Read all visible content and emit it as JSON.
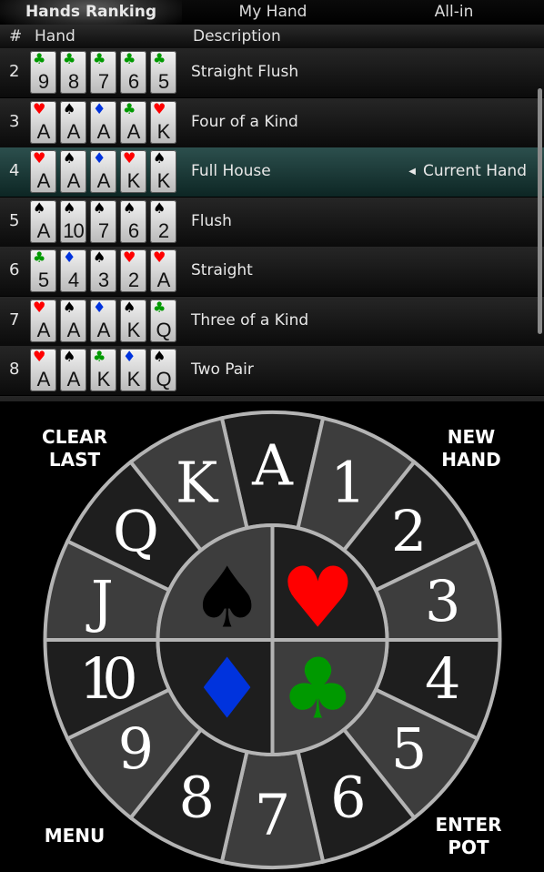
{
  "tabs": [
    {
      "label": "Hands Ranking",
      "active": true
    },
    {
      "label": "My Hand",
      "active": false
    },
    {
      "label": "All-in",
      "active": false
    }
  ],
  "table": {
    "columns": {
      "rank": "#",
      "hand": "Hand",
      "description": "Description"
    },
    "current_marker": "Current Hand",
    "rows": [
      {
        "rank": "2",
        "description": "Straight Flush",
        "current": false,
        "cards": [
          {
            "suit": "clubs",
            "value": "9"
          },
          {
            "suit": "clubs",
            "value": "8"
          },
          {
            "suit": "clubs",
            "value": "7"
          },
          {
            "suit": "clubs",
            "value": "6"
          },
          {
            "suit": "clubs",
            "value": "5"
          }
        ]
      },
      {
        "rank": "3",
        "description": "Four of a Kind",
        "current": false,
        "cards": [
          {
            "suit": "hearts",
            "value": "A"
          },
          {
            "suit": "spades",
            "value": "A"
          },
          {
            "suit": "diamonds",
            "value": "A"
          },
          {
            "suit": "clubs",
            "value": "A"
          },
          {
            "suit": "hearts",
            "value": "K"
          }
        ]
      },
      {
        "rank": "4",
        "description": "Full House",
        "current": true,
        "cards": [
          {
            "suit": "hearts",
            "value": "A"
          },
          {
            "suit": "spades",
            "value": "A"
          },
          {
            "suit": "diamonds",
            "value": "A"
          },
          {
            "suit": "hearts",
            "value": "K"
          },
          {
            "suit": "spades",
            "value": "K"
          }
        ]
      },
      {
        "rank": "5",
        "description": "Flush",
        "current": false,
        "cards": [
          {
            "suit": "spades",
            "value": "A"
          },
          {
            "suit": "spades",
            "value": "10"
          },
          {
            "suit": "spades",
            "value": "7"
          },
          {
            "suit": "spades",
            "value": "6"
          },
          {
            "suit": "spades",
            "value": "2"
          }
        ]
      },
      {
        "rank": "6",
        "description": "Straight",
        "current": false,
        "cards": [
          {
            "suit": "clubs",
            "value": "5"
          },
          {
            "suit": "diamonds",
            "value": "4"
          },
          {
            "suit": "spades",
            "value": "3"
          },
          {
            "suit": "hearts",
            "value": "2"
          },
          {
            "suit": "hearts",
            "value": "A"
          }
        ]
      },
      {
        "rank": "7",
        "description": "Three of a Kind",
        "current": false,
        "cards": [
          {
            "suit": "hearts",
            "value": "A"
          },
          {
            "suit": "spades",
            "value": "A"
          },
          {
            "suit": "diamonds",
            "value": "A"
          },
          {
            "suit": "spades",
            "value": "K"
          },
          {
            "suit": "clubs",
            "value": "Q"
          }
        ]
      },
      {
        "rank": "8",
        "description": "Two Pair",
        "current": false,
        "cards": [
          {
            "suit": "hearts",
            "value": "A"
          },
          {
            "suit": "spades",
            "value": "A"
          },
          {
            "suit": "clubs",
            "value": "K"
          },
          {
            "suit": "diamonds",
            "value": "K"
          },
          {
            "suit": "spades",
            "value": "Q"
          }
        ]
      }
    ]
  },
  "suits": {
    "spades": {
      "glyph": "♠",
      "color": "#000000",
      "icon": "spade-icon"
    },
    "hearts": {
      "glyph": "♥",
      "color": "#ff0000",
      "icon": "heart-icon"
    },
    "diamonds": {
      "glyph": "♦",
      "color": "#0033dd",
      "icon": "diamond-icon"
    },
    "clubs": {
      "glyph": "♣",
      "color": "#009900",
      "icon": "club-icon"
    }
  },
  "wheel": {
    "values": [
      "A",
      "1",
      "2",
      "3",
      "4",
      "5",
      "6",
      "7",
      "8",
      "9",
      "10",
      "J",
      "Q",
      "K"
    ],
    "suit_buttons": [
      {
        "suit": "spades"
      },
      {
        "suit": "hearts"
      },
      {
        "suit": "diamonds"
      },
      {
        "suit": "clubs"
      }
    ],
    "colors": {
      "dark": "#1e1e1e",
      "light": "#3d3d3d",
      "stroke": "#b4b4b4"
    }
  },
  "corner_buttons": {
    "clear_last": [
      "CLEAR",
      "LAST"
    ],
    "new_hand": [
      "NEW",
      "HAND"
    ],
    "menu": [
      "MENU"
    ],
    "enter_pot": [
      "ENTER",
      "POT"
    ]
  }
}
